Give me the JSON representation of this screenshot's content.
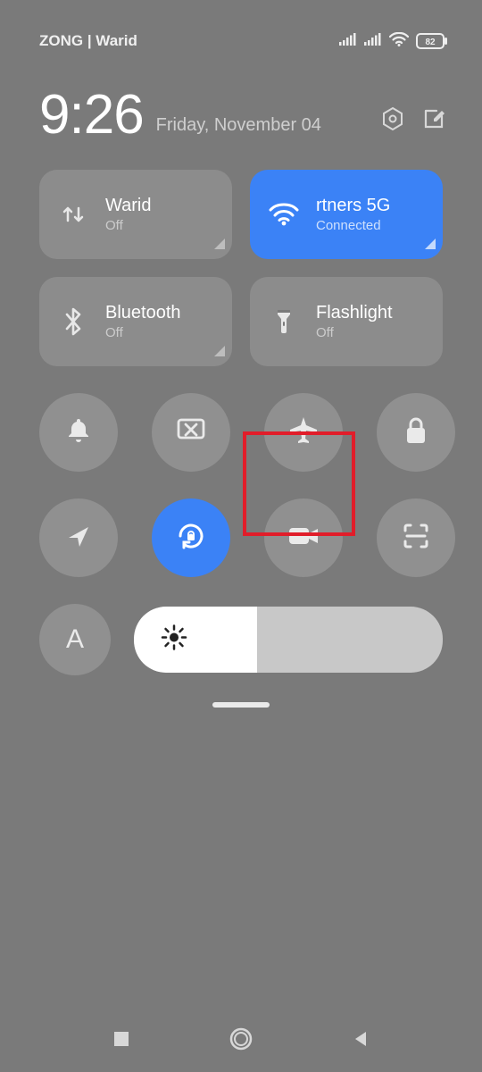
{
  "status": {
    "carrier": "ZONG | Warid",
    "battery": "82"
  },
  "header": {
    "time": "9:26",
    "date": "Friday, November 04"
  },
  "tiles": {
    "data": {
      "title": "Warid",
      "sub": "Off"
    },
    "wifi": {
      "title": "rtners 5G",
      "sub": "Connected"
    },
    "bluetooth": {
      "title": "Bluetooth",
      "sub": "Off"
    },
    "flashlight": {
      "title": "Flashlight",
      "sub": "Off"
    }
  },
  "brightness": {
    "auto_label": "A",
    "percent": 40
  }
}
